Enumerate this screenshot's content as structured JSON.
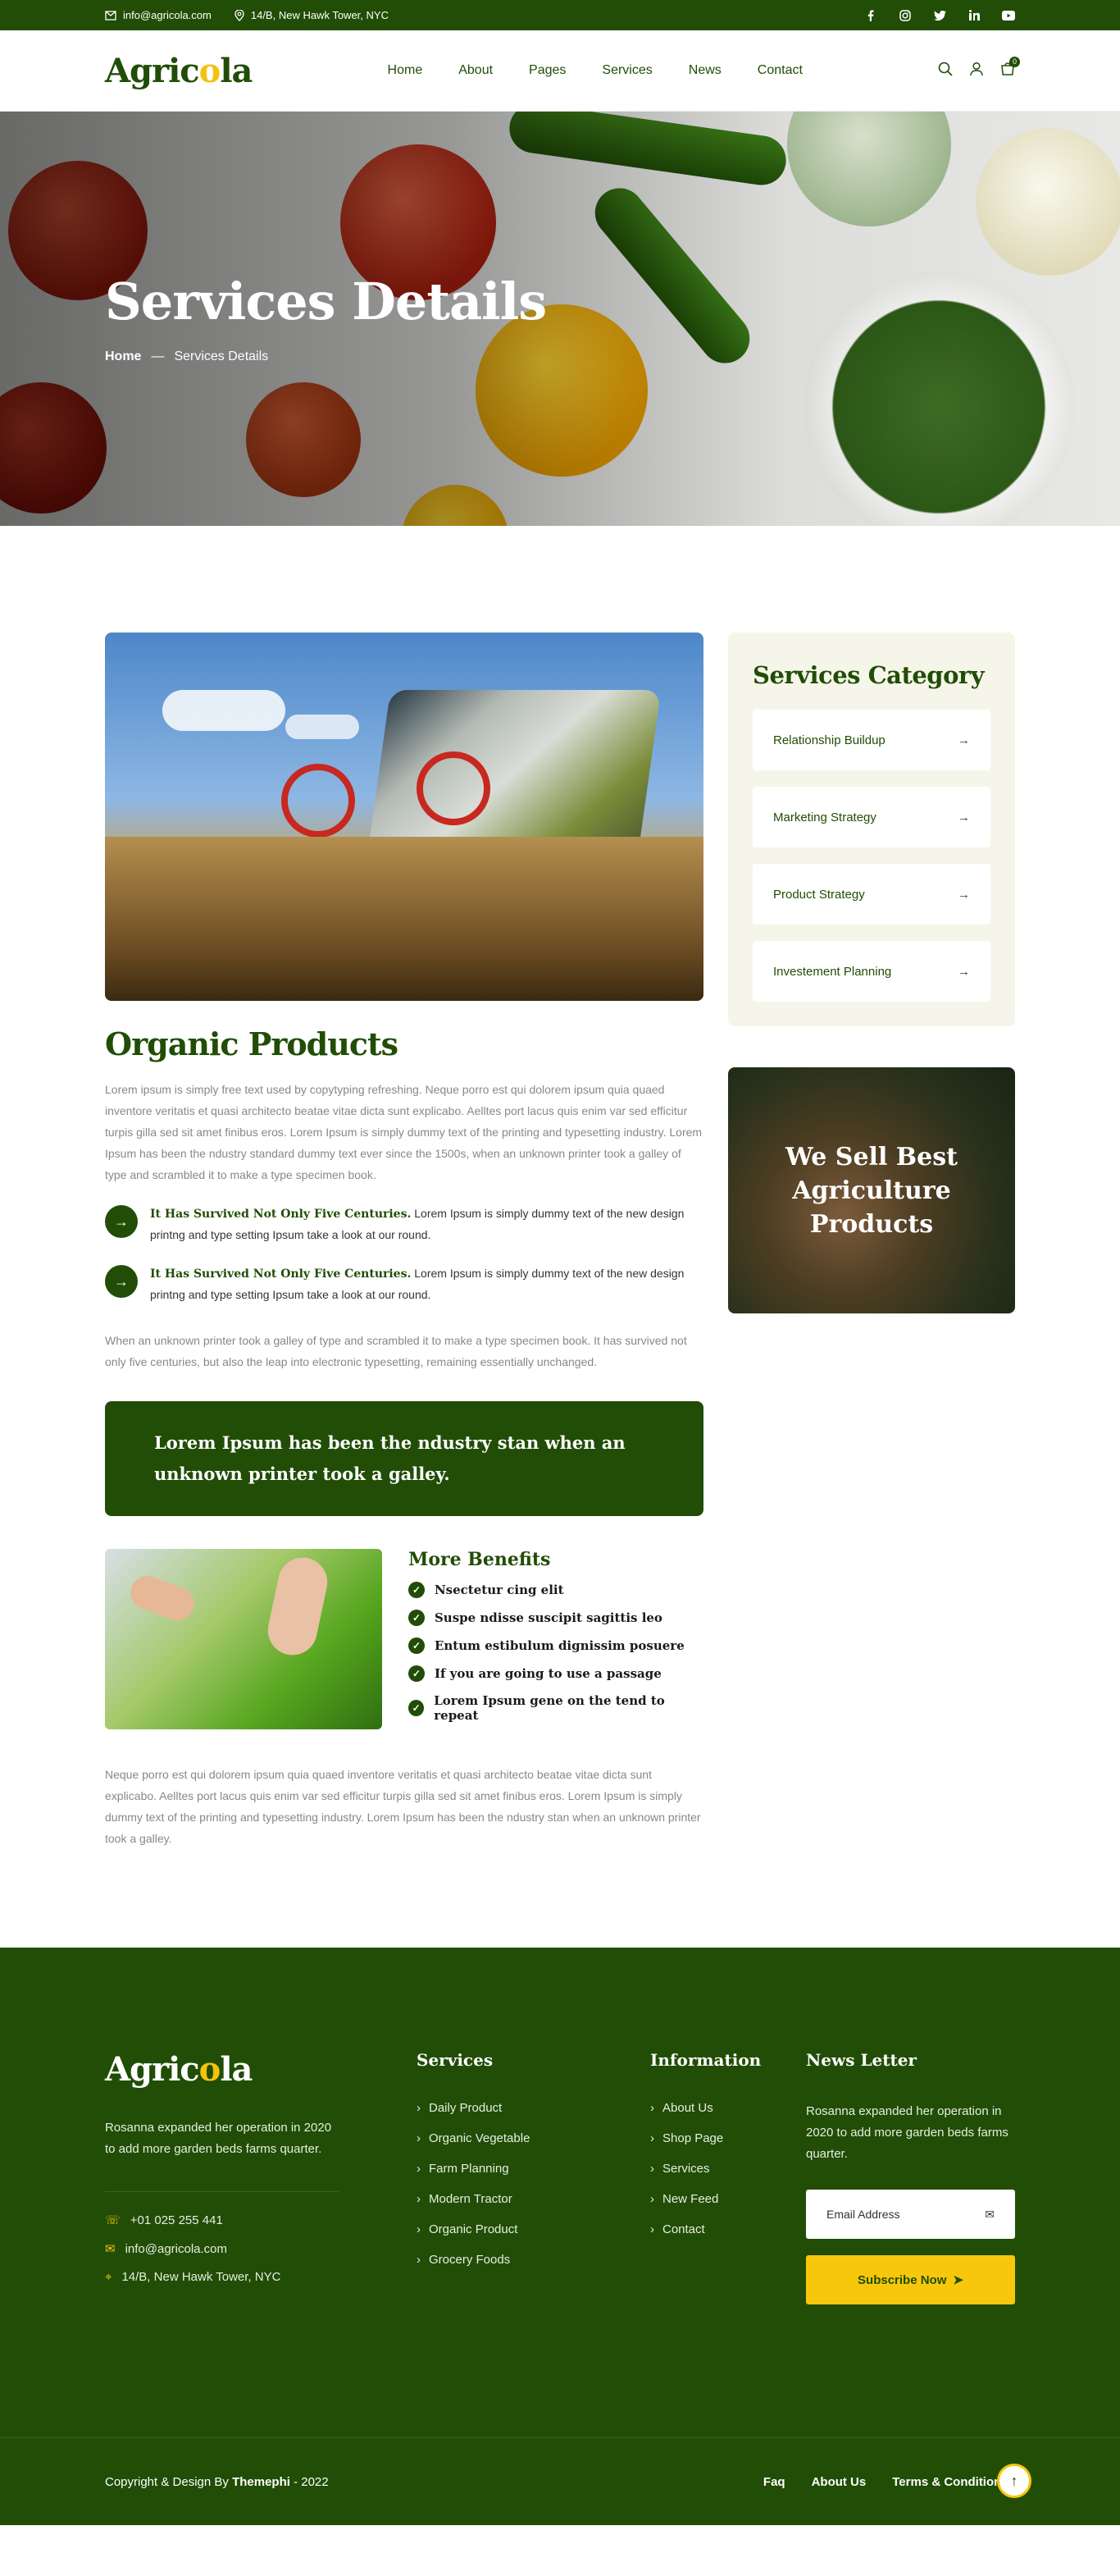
{
  "topbar": {
    "email": "info@agricola.com",
    "address": "14/B, New Hawk Tower, NYC",
    "social": [
      "facebook-icon",
      "instagram-icon",
      "twitter-icon",
      "linkedin-icon",
      "youtube-icon"
    ]
  },
  "header": {
    "logo_pre": "Agric",
    "logo_o": "o",
    "logo_post": "la",
    "nav": [
      "Home",
      "About",
      "Pages",
      "Services",
      "News",
      "Contact"
    ],
    "cart_count": "0"
  },
  "hero": {
    "title": "Services Details",
    "crumb_home": "Home",
    "crumb_sep": "—",
    "crumb_current": "Services Details"
  },
  "main": {
    "title": "Organic Products",
    "para1": "Lorem ipsum is simply free text used by copytyping refreshing. Neque porro est qui dolorem ipsum quia quaed inventore veritatis et quasi architecto beatae vitae dicta sunt explicabo. Aelltes port lacus quis enim var sed efficitur turpis gilla sed sit amet finibus eros. Lorem Ipsum is simply dummy text of the printing and typesetting industry. Lorem Ipsum has been the ndustry standard dummy text ever since the 1500s, when an unknown printer took a galley of type and scrambled it to make a type specimen book.",
    "points": [
      {
        "bold": "It Has Survived Not Only Five Centuries.",
        "text": " Lorem Ipsum is simply dummy text of the new design printng and type setting Ipsum take a look at our round."
      },
      {
        "bold": "It Has Survived Not Only Five Centuries.",
        "text": " Lorem Ipsum is simply dummy text of the new design printng and type setting Ipsum take a look at our round."
      }
    ],
    "para2": "When an unknown printer took a galley of type and scrambled it to make a type specimen book. It has survived not only five centuries, but also the leap into electronic typesetting, remaining essentially unchanged.",
    "quote": "Lorem Ipsum has been the ndustry stan when an unknown printer took a galley.",
    "benefits_title": "More Benefits",
    "benefits": [
      "Nsectetur cing elit",
      "Suspe ndisse suscipit sagittis leo",
      "Entum estibulum dignissim posuere",
      "If you are going to use a passage",
      "Lorem Ipsum gene on the tend to repeat"
    ],
    "para3": "Neque porro est qui dolorem ipsum quia quaed inventore veritatis et quasi architecto beatae vitae dicta sunt explicabo. Aelltes port lacus quis enim var sed efficitur turpis gilla sed sit amet finibus eros. Lorem Ipsum is simply dummy text of the printing and typesetting industry. Lorem Ipsum has been the ndustry stan when an unknown printer took a galley."
  },
  "sidebar": {
    "title": "Services Category",
    "items": [
      "Relationship Buildup",
      "Marketing Strategy",
      "Product Strategy",
      "Investement Planning"
    ],
    "promo": "We Sell Best Agriculture Products"
  },
  "footer": {
    "about": "Rosanna expanded her operation in 2020 to add more garden beds farms quarter.",
    "phone": "+01 025 255 441",
    "email": "info@agricola.com",
    "address": "14/B, New Hawk Tower, NYC",
    "services_title": "Services",
    "services": [
      "Daily Product",
      "Organic Vegetable",
      "Farm Planning",
      "Modern Tractor",
      "Organic Product",
      "Grocery Foods"
    ],
    "info_title": "Information",
    "info": [
      "About Us",
      "Shop Page",
      "Services",
      "New Feed",
      "Contact"
    ],
    "news_title": "News Letter",
    "news_text": "Rosanna expanded her operation in 2020 to add more garden beds farms quarter.",
    "email_placeholder": "Email Address",
    "subscribe": "Subscribe Now",
    "copyright_pre": "Copyright & Design By ",
    "copyright_brand": "Themephi",
    "copyright_post": " - 2022",
    "bottom_links": [
      "Faq",
      "About Us",
      "Terms & Conditionss"
    ]
  },
  "colors": {
    "primary": "#214d06",
    "accent": "#f7c70c",
    "sidebar_bg": "#f5f6e9"
  }
}
